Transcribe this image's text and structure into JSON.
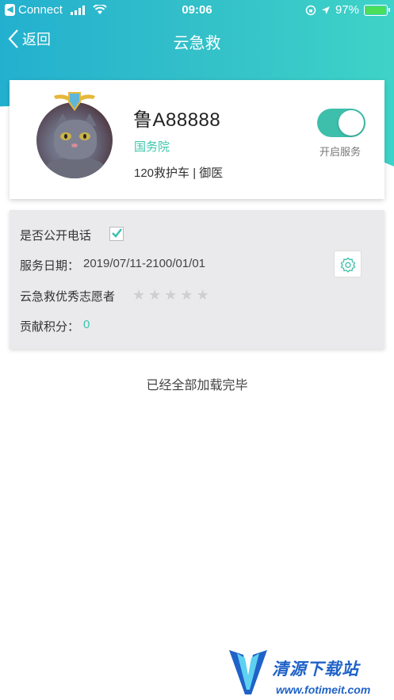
{
  "status_bar": {
    "back_app_icon": "back-arrow-icon",
    "carrier": "Connect",
    "time": "09:06",
    "battery": "97%",
    "battery_level": 0.97
  },
  "nav": {
    "back_label": "返回",
    "title": "云急救"
  },
  "profile": {
    "plate": "鲁A88888",
    "organization": "国务院",
    "role": "120救护车 | 御医",
    "service_toggle_label": "开启服务",
    "service_enabled": true,
    "avatar_icon": "cat-avatar",
    "badge_icon": "shield-wings-badge-icon"
  },
  "details": {
    "public_phone_label": "是否公开电话",
    "public_phone_checked": true,
    "service_date_label": "服务日期：",
    "service_date_value": "2019/07/11-2100/01/01",
    "volunteer_label": "云急救优秀志愿者",
    "star_rating": 0,
    "star_max": 5,
    "points_label": "贡献积分：",
    "points_value": "0"
  },
  "footer": {
    "load_done": "已经全部加载完毕"
  },
  "watermark": {
    "brand": "清源下载站",
    "url": "www.fotimeit.com"
  },
  "colors": {
    "accent": "#3dbfab",
    "header_start": "#23b0cf",
    "header_end": "#3ed3c8"
  }
}
